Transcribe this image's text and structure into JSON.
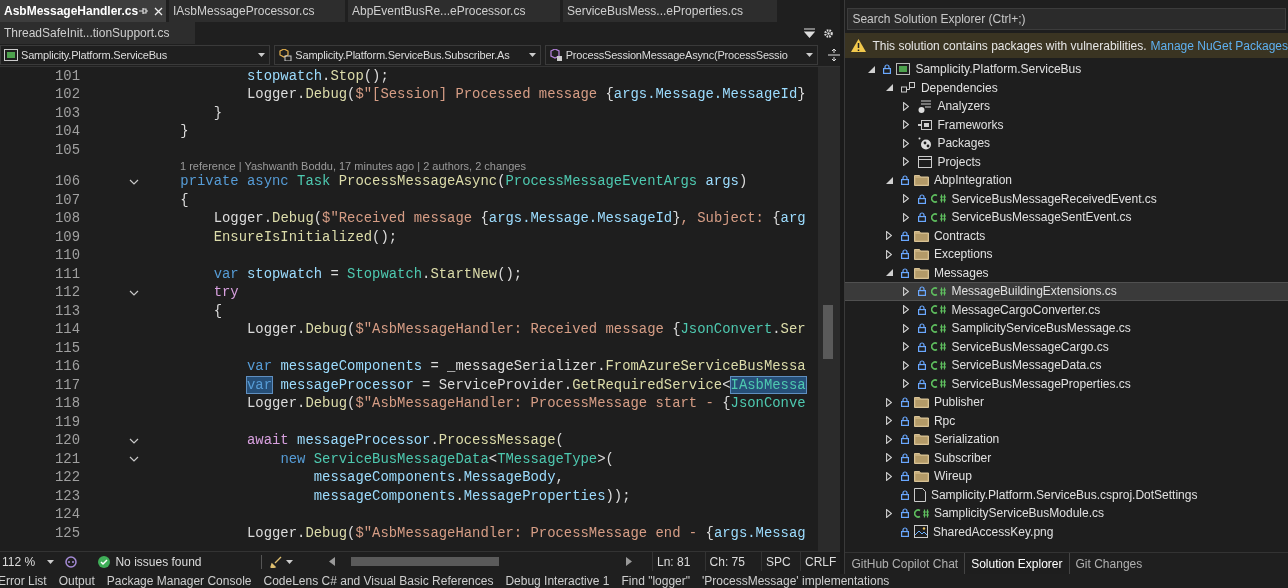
{
  "tab_rows": [
    [
      {
        "label": "AsbMessageHandler.cs",
        "selected": true,
        "pinned": true
      },
      {
        "label": "IAsbMessageProcessor.cs",
        "selected": false,
        "pinned": false
      },
      {
        "label": "AbpEventBusRe...eProcessor.cs",
        "selected": false,
        "pinned": false
      },
      {
        "label": "ServiceBusMess...eProperties.cs",
        "selected": false,
        "pinned": false
      }
    ],
    [
      {
        "label": "ThreadSafeInit...tionSupport.cs",
        "selected": false,
        "pinned": false
      }
    ]
  ],
  "navigation_bar": [
    {
      "label": "Samplicity.Platform.ServiceBus",
      "kind": "project"
    },
    {
      "label": "Samplicity.Platform.ServiceBus.Subscriber.As",
      "kind": "class"
    },
    {
      "label": "ProcessSessionMessageAsync(ProcessSessio",
      "kind": "method"
    }
  ],
  "code_lines": [
    {
      "kind": "code",
      "number": "101",
      "foldable": false,
      "tokens": [
        {
          "text": "            stopwatch",
          "kind": "local"
        },
        {
          "text": ".",
          "kind": "p"
        },
        {
          "text": "Stop",
          "kind": "method"
        },
        {
          "text": "();",
          "kind": "p"
        }
      ]
    },
    {
      "kind": "code",
      "number": "102",
      "foldable": false,
      "tokens": [
        {
          "text": "            Logger.",
          "kind": "p"
        },
        {
          "text": "Debug",
          "kind": "method"
        },
        {
          "text": "(",
          "kind": "p"
        },
        {
          "text": "$\"[Session] Processed message ",
          "kind": "str"
        },
        {
          "text": "{",
          "kind": "p"
        },
        {
          "text": "args.Message.MessageId",
          "kind": "local"
        },
        {
          "text": "}",
          "kind": "p"
        }
      ]
    },
    {
      "kind": "code",
      "number": "103",
      "foldable": false,
      "tokens": [
        {
          "text": "        }",
          "kind": "p"
        }
      ]
    },
    {
      "kind": "code",
      "number": "104",
      "foldable": false,
      "tokens": [
        {
          "text": "    }",
          "kind": "p"
        }
      ]
    },
    {
      "kind": "code",
      "number": "105",
      "foldable": false
    },
    {
      "kind": "codelens",
      "text": "1 reference | Yashwanth Boddu, 17 minutes ago | 2 authors, 2 changes"
    },
    {
      "kind": "code",
      "number": "106",
      "foldable": true,
      "tokens": [
        {
          "text": "    private ",
          "kind": "kw"
        },
        {
          "text": "async ",
          "kind": "kw"
        },
        {
          "text": "Task ",
          "kind": "type"
        },
        {
          "text": "ProcessMessageAsync",
          "kind": "method"
        },
        {
          "text": "(",
          "kind": "p"
        },
        {
          "text": "ProcessMessageEventArgs ",
          "kind": "type"
        },
        {
          "text": "args",
          "kind": "local"
        },
        {
          "text": ")",
          "kind": "p"
        }
      ]
    },
    {
      "kind": "code",
      "number": "107",
      "foldable": false,
      "tokens": [
        {
          "text": "    {",
          "kind": "p"
        }
      ]
    },
    {
      "kind": "code",
      "number": "108",
      "foldable": false,
      "tokens": [
        {
          "text": "        Logger.",
          "kind": "p"
        },
        {
          "text": "Debug",
          "kind": "method"
        },
        {
          "text": "(",
          "kind": "p"
        },
        {
          "text": "$\"Received message ",
          "kind": "str"
        },
        {
          "text": "{",
          "kind": "p"
        },
        {
          "text": "args.Message.MessageId",
          "kind": "local"
        },
        {
          "text": "}",
          "kind": "p"
        },
        {
          "text": ", Subject: ",
          "kind": "str"
        },
        {
          "text": "{",
          "kind": "p"
        },
        {
          "text": "arg",
          "kind": "local"
        }
      ]
    },
    {
      "kind": "code",
      "number": "109",
      "foldable": false,
      "tokens": [
        {
          "text": "        EnsureIsInitialized",
          "kind": "method"
        },
        {
          "text": "();",
          "kind": "p"
        }
      ]
    },
    {
      "kind": "code",
      "number": "110",
      "foldable": false
    },
    {
      "kind": "code",
      "number": "111",
      "foldable": false,
      "tokens": [
        {
          "text": "        var ",
          "kind": "kw"
        },
        {
          "text": "stopwatch",
          "kind": "local"
        },
        {
          "text": " = ",
          "kind": "p"
        },
        {
          "text": "Stopwatch",
          "kind": "type"
        },
        {
          "text": ".",
          "kind": "p"
        },
        {
          "text": "StartNew",
          "kind": "method"
        },
        {
          "text": "();",
          "kind": "p"
        }
      ]
    },
    {
      "kind": "code",
      "number": "112",
      "foldable": true,
      "tokens": [
        {
          "text": "        try",
          "kind": "ctl"
        }
      ]
    },
    {
      "kind": "code",
      "number": "113",
      "foldable": false,
      "tokens": [
        {
          "text": "        {",
          "kind": "p"
        }
      ]
    },
    {
      "kind": "code",
      "number": "114",
      "foldable": false,
      "tokens": [
        {
          "text": "            Logger.",
          "kind": "p"
        },
        {
          "text": "Debug",
          "kind": "method"
        },
        {
          "text": "(",
          "kind": "p"
        },
        {
          "text": "$\"AsbMessageHandler: Received message ",
          "kind": "str"
        },
        {
          "text": "{",
          "kind": "p"
        },
        {
          "text": "JsonConvert",
          "kind": "type"
        },
        {
          "text": ".",
          "kind": "p"
        },
        {
          "text": "Ser",
          "kind": "method"
        }
      ]
    },
    {
      "kind": "code",
      "number": "115",
      "foldable": false
    },
    {
      "kind": "code",
      "number": "116",
      "foldable": false,
      "tokens": [
        {
          "text": "            var ",
          "kind": "kw"
        },
        {
          "text": "messageComponents",
          "kind": "local"
        },
        {
          "text": " = _messageSerializer.",
          "kind": "p"
        },
        {
          "text": "FromAzureServiceBusMessa",
          "kind": "method"
        }
      ]
    },
    {
      "kind": "code",
      "number": "117",
      "foldable": false,
      "tokens": [
        {
          "text": "            var",
          "kind": "kw_sel"
        },
        {
          "text": " messageProcessor",
          "kind": "local"
        },
        {
          "text": " = ServiceProvider.",
          "kind": "p"
        },
        {
          "text": "GetRequiredService",
          "kind": "method"
        },
        {
          "text": "<",
          "kind": "p"
        },
        {
          "text": "IAsbMessa",
          "kind": "type_sel"
        }
      ]
    },
    {
      "kind": "code",
      "number": "118",
      "foldable": false,
      "tokens": [
        {
          "text": "            Logger.",
          "kind": "p"
        },
        {
          "text": "Debug",
          "kind": "method"
        },
        {
          "text": "(",
          "kind": "p"
        },
        {
          "text": "$\"AsbMessageHandler: ProcessMessage start - ",
          "kind": "str"
        },
        {
          "text": "{",
          "kind": "p"
        },
        {
          "text": "JsonConve",
          "kind": "type"
        }
      ]
    },
    {
      "kind": "code",
      "number": "119",
      "foldable": false
    },
    {
      "kind": "code",
      "number": "120",
      "foldable": true,
      "tokens": [
        {
          "text": "            await ",
          "kind": "ctl"
        },
        {
          "text": "messageProcessor",
          "kind": "local"
        },
        {
          "text": ".",
          "kind": "p"
        },
        {
          "text": "ProcessMessage",
          "kind": "method"
        },
        {
          "text": "(",
          "kind": "p"
        }
      ]
    },
    {
      "kind": "code",
      "number": "121",
      "foldable": true,
      "tokens": [
        {
          "text": "                new ",
          "kind": "kw"
        },
        {
          "text": "ServiceBusMessageData",
          "kind": "type"
        },
        {
          "text": "<",
          "kind": "p"
        },
        {
          "text": "TMessageType",
          "kind": "type"
        },
        {
          "text": ">(",
          "kind": "p"
        }
      ]
    },
    {
      "kind": "code",
      "number": "122",
      "foldable": false,
      "tokens": [
        {
          "text": "                    messageComponents",
          "kind": "local"
        },
        {
          "text": ".",
          "kind": "p"
        },
        {
          "text": "MessageBody",
          "kind": "local"
        },
        {
          "text": ",",
          "kind": "p"
        }
      ]
    },
    {
      "kind": "code",
      "number": "123",
      "foldable": false,
      "tokens": [
        {
          "text": "                    messageComponents",
          "kind": "local"
        },
        {
          "text": ".",
          "kind": "p"
        },
        {
          "text": "MessageProperties",
          "kind": "local"
        },
        {
          "text": "));",
          "kind": "p"
        }
      ]
    },
    {
      "kind": "code",
      "number": "124",
      "foldable": false
    },
    {
      "kind": "code",
      "number": "125",
      "foldable": false,
      "tokens": [
        {
          "text": "            Logger.",
          "kind": "p"
        },
        {
          "text": "Debug",
          "kind": "method"
        },
        {
          "text": "(",
          "kind": "p"
        },
        {
          "text": "$\"AsbMessageHandler: ProcessMessage end - ",
          "kind": "str"
        },
        {
          "text": "{",
          "kind": "p"
        },
        {
          "text": "args.Messag",
          "kind": "local"
        }
      ]
    }
  ],
  "status_bar": {
    "zoom": "112 %",
    "issues": "No issues found",
    "line": "Ln: 81",
    "column": "Ch: 75",
    "whitespace": "SPC",
    "line_ending": "CRLF"
  },
  "solution_explorer": {
    "search_placeholder": "Search Solution Explorer (Ctrl+;)",
    "warning": {
      "message": "This solution contains packages with vulnerabilities.",
      "link": "Manage NuGet Packages"
    },
    "tree": [
      {
        "label": "Samplicity.Platform.ServiceBus",
        "kind": "project",
        "locked": true,
        "expanded": true,
        "selected": false,
        "children": [
          {
            "label": "Dependencies",
            "kind": "dependencies",
            "locked": false,
            "expanded": true,
            "selected": false,
            "children": [
              {
                "label": "Analyzers",
                "kind": "analyzers",
                "locked": false,
                "expanded": false,
                "selected": false
              },
              {
                "label": "Frameworks",
                "kind": "frameworks",
                "locked": false,
                "expanded": false,
                "selected": false
              },
              {
                "label": "Packages",
                "kind": "packages",
                "locked": false,
                "expanded": false,
                "selected": false
              },
              {
                "label": "Projects",
                "kind": "projects",
                "locked": false,
                "expanded": false,
                "selected": false
              }
            ]
          },
          {
            "label": "AbpIntegration",
            "kind": "folder",
            "locked": true,
            "expanded": true,
            "selected": false,
            "children": [
              {
                "label": "ServiceBusMessageReceivedEvent.cs",
                "kind": "csharp",
                "locked": true,
                "expanded": false,
                "selected": false
              },
              {
                "label": "ServiceBusMessageSentEvent.cs",
                "kind": "csharp",
                "locked": true,
                "expanded": false,
                "selected": false
              }
            ]
          },
          {
            "label": "Contracts",
            "kind": "folder",
            "locked": true,
            "expanded": false,
            "selected": false
          },
          {
            "label": "Exceptions",
            "kind": "folder",
            "locked": true,
            "expanded": false,
            "selected": false
          },
          {
            "label": "Messages",
            "kind": "folder",
            "locked": true,
            "expanded": true,
            "selected": false,
            "children": [
              {
                "label": "MessageBuildingExtensions.cs",
                "kind": "csharp",
                "locked": true,
                "expanded": false,
                "selected": true
              },
              {
                "label": "MessageCargoConverter.cs",
                "kind": "csharp",
                "locked": true,
                "expanded": false,
                "selected": false
              },
              {
                "label": "SamplicityServiceBusMessage.cs",
                "kind": "csharp",
                "locked": true,
                "expanded": false,
                "selected": false
              },
              {
                "label": "ServiceBusMessageCargo.cs",
                "kind": "csharp",
                "locked": true,
                "expanded": false,
                "selected": false
              },
              {
                "label": "ServiceBusMessageData.cs",
                "kind": "csharp",
                "locked": true,
                "expanded": false,
                "selected": false
              },
              {
                "label": "ServiceBusMessageProperties.cs",
                "kind": "csharp",
                "locked": true,
                "expanded": false,
                "selected": false
              }
            ]
          },
          {
            "label": "Publisher",
            "kind": "folder",
            "locked": true,
            "expanded": false,
            "selected": false
          },
          {
            "label": "Rpc",
            "kind": "folder",
            "locked": true,
            "expanded": false,
            "selected": false
          },
          {
            "label": "Serialization",
            "kind": "folder",
            "locked": true,
            "expanded": false,
            "selected": false
          },
          {
            "label": "Subscriber",
            "kind": "folder",
            "locked": true,
            "expanded": false,
            "selected": false
          },
          {
            "label": "Wireup",
            "kind": "folder",
            "locked": true,
            "expanded": false,
            "selected": false
          },
          {
            "label": "Samplicity.Platform.ServiceBus.csproj.DotSettings",
            "kind": "file",
            "locked": true,
            "selected": false
          },
          {
            "label": "SamplicityServiceBusModule.cs",
            "kind": "csharp",
            "locked": true,
            "expanded": false,
            "selected": false
          },
          {
            "label": "SharedAccessKey.png",
            "kind": "image",
            "locked": true,
            "selected": false
          }
        ]
      }
    ]
  },
  "tool_tabs": [
    {
      "label": "GitHub Copilot Chat",
      "selected": false
    },
    {
      "label": "Solution Explorer",
      "selected": true
    },
    {
      "label": "Git Changes",
      "selected": false
    }
  ],
  "bottom_tabs": [
    {
      "label": "Error List"
    },
    {
      "label": "Output"
    },
    {
      "label": "Package Manager Console"
    },
    {
      "label": "CodeLens C# and Visual Basic References"
    },
    {
      "label": "Debug Interactive 1"
    },
    {
      "label": "Find \"logger\""
    },
    {
      "label": "'ProcessMessage' implementations"
    }
  ]
}
